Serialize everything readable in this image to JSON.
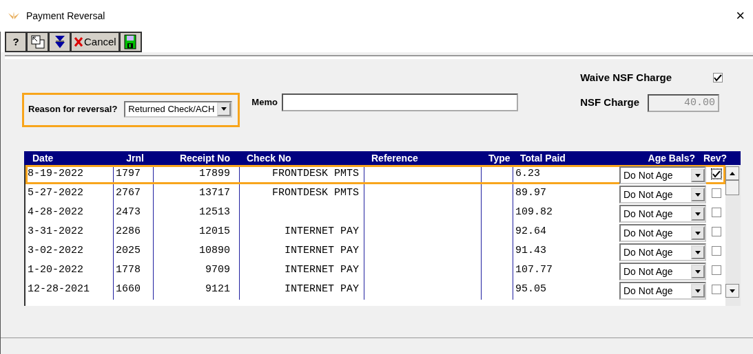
{
  "window": {
    "title": "Payment Reversal",
    "close": "×"
  },
  "toolbar": [
    {
      "kind": "help",
      "label": "?"
    },
    {
      "kind": "restore"
    },
    {
      "kind": "down"
    },
    {
      "kind": "cancel",
      "label": "Cancel"
    },
    {
      "kind": "save"
    }
  ],
  "reason": {
    "label": "Reason for reversal?",
    "value": "Returned Check/ACH",
    "highlighted": true
  },
  "memo": {
    "label": "Memo"
  },
  "waive_nsf": {
    "label": "Waive NSF Charge",
    "checked": true
  },
  "nsf_charge": {
    "label": "NSF Charge",
    "value": "40.00",
    "disabled": true
  },
  "table": {
    "columns": [
      "Date",
      "Jrnl",
      "Receipt No",
      "Check No",
      "Reference",
      "Type",
      "Total Paid",
      "Age Bals?",
      "Rev?"
    ],
    "rows": [
      {
        "date": "8-19-2022",
        "jrnl": "1797",
        "receipt": "17899",
        "check": "FRONTDESK PMTS",
        "total": "6.23",
        "age": "Do Not Age",
        "rev": true,
        "highlighted": true
      },
      {
        "date": "5-27-2022",
        "jrnl": "2767",
        "receipt": "13717",
        "check": "FRONTDESK PMTS",
        "total": "89.97",
        "age": "Do Not Age",
        "rev": false,
        "highlighted": false
      },
      {
        "date": "4-28-2022",
        "jrnl": "2473",
        "receipt": "12513",
        "total": "109.82",
        "age": "Do Not Age",
        "rev": false,
        "highlighted": false
      },
      {
        "date": "3-31-2022",
        "jrnl": "2286",
        "receipt": "12015",
        "check": "INTERNET PAY",
        "total": "92.64",
        "age": "Do Not Age",
        "rev": false,
        "highlighted": false
      },
      {
        "date": "3-02-2022",
        "jrnl": "2025",
        "receipt": "10890",
        "check": "INTERNET PAY",
        "total": "91.43",
        "age": "Do Not Age",
        "rev": false,
        "highlighted": false
      },
      {
        "date": "1-20-2022",
        "jrnl": "1778",
        "receipt": "9709",
        "check": "INTERNET PAY",
        "total": "107.77",
        "age": "Do Not Age",
        "rev": false,
        "highlighted": false
      },
      {
        "date": "12-28-2021",
        "jrnl": "1660",
        "receipt": "9121",
        "check": "INTERNET PAY",
        "total": "95.05",
        "age": "Do Not Age",
        "rev": false,
        "highlighted": false
      }
    ]
  }
}
